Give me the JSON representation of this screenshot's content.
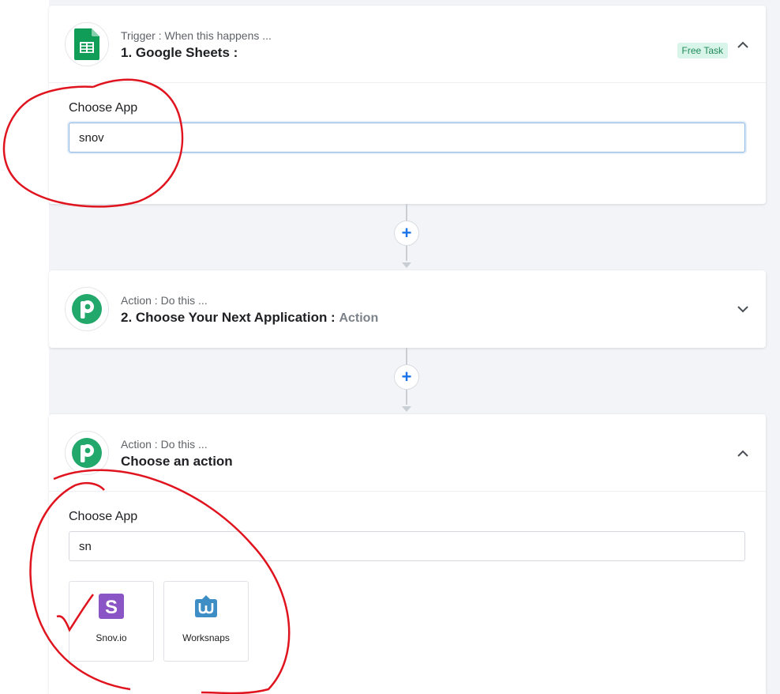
{
  "steps": [
    {
      "sub": "Trigger : When this happens ...",
      "title": "1. Google Sheets :",
      "badge": "Free Task",
      "icon": "google-sheets-icon",
      "expanded": true,
      "field_label": "Choose App",
      "input_value": "snov"
    },
    {
      "sub": "Action : Do this ...",
      "title": "2. Choose Your Next Application :",
      "title_suffix": "Action",
      "icon": "pabbly-logo-icon",
      "expanded": false
    },
    {
      "sub": "Action : Do this ...",
      "title": "Choose an action",
      "icon": "pabbly-logo-icon",
      "expanded": true,
      "field_label": "Choose App",
      "input_value": "sn",
      "apps": [
        {
          "label": "Snov.io",
          "icon": "snovio-icon",
          "color": "#8a55c4"
        },
        {
          "label": "Worksnaps",
          "icon": "worksnaps-icon",
          "color": "#3d8ec5"
        }
      ]
    }
  ],
  "connectors": [
    {
      "icon": "plus-icon",
      "label": "+"
    },
    {
      "icon": "plus-icon",
      "label": "+"
    }
  ],
  "colors": {
    "accent_blue": "#1a73e8",
    "sheets_green": "#0f9d58",
    "pabbly_green": "#22a86b",
    "badge_bg": "#d9f4e8",
    "annotation_red": "#e0141e"
  }
}
